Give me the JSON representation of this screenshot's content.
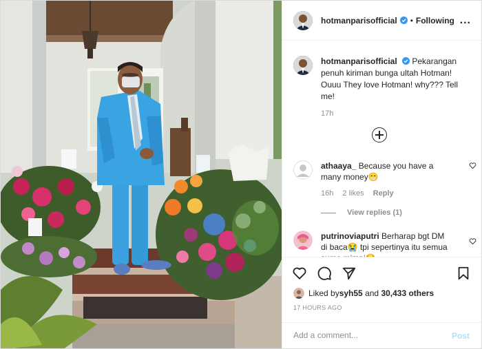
{
  "header": {
    "username": "hotmanparisofficial",
    "separator": "•",
    "follow_status": "Following",
    "more_label": "..."
  },
  "caption": {
    "username": "hotmanparisofficial",
    "text": "Pekarangan penuh kiriman bunga ultah Hotman! Ouuu They love Hotman! why??? Tell me!",
    "time": "17h"
  },
  "comments": [
    {
      "username": "athaaya_",
      "text": "Because you have a many money😁",
      "time": "16h",
      "likes": "2 likes",
      "reply": "Reply"
    },
    {
      "username": "putrinoviaputri",
      "text": "Berharap bgt DM di baca😭 tpi sepertinya itu semua sumo mimpi😪"
    }
  ],
  "view_replies": "View replies (1)",
  "likes_line": {
    "prefix": "Liked by ",
    "user": "syh55",
    "middle": " and ",
    "count": "30,433 others"
  },
  "timestamp": "17 HOURS AGO",
  "add_comment": {
    "placeholder": "Add a comment...",
    "post_label": "Post"
  },
  "colors": {
    "accent_blue": "#0095f6",
    "post_disabled": "#b2dffc",
    "muted": "#8e8e8e",
    "suit_blue": "#3aa0e0"
  },
  "icons": [
    "heart-icon",
    "comment-icon",
    "share-icon",
    "bookmark-icon",
    "add-circle-icon",
    "verified-badge-icon",
    "more-options-icon"
  ]
}
